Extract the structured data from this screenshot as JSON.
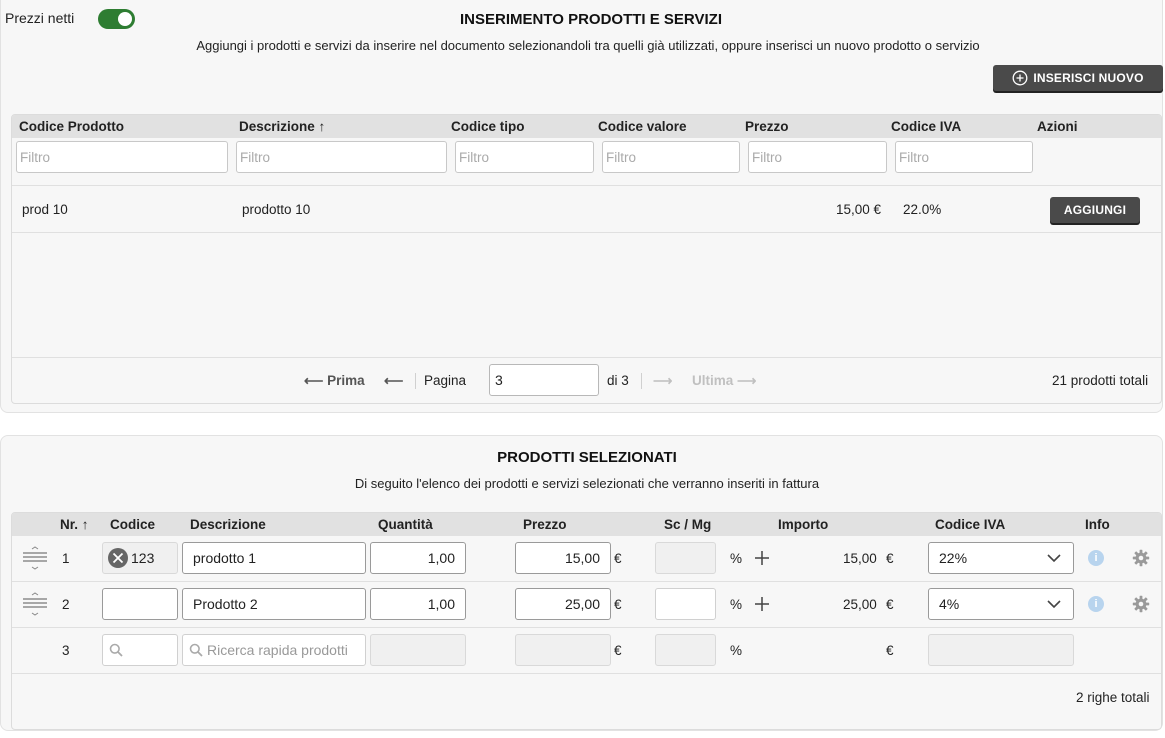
{
  "toggle": {
    "label": "Prezzi netti",
    "checked": true,
    "color": "#2e7d32"
  },
  "insert": {
    "title": "INSERIMENTO PRODOTTI E SERVIZI",
    "subtitle": "Aggiungi i prodotti e servizi da inserire nel documento selezionandoli tra quelli già utilizzati, oppure inserisci un nuovo prodotto o servizio",
    "new_button": "INSERISCI NUOVO",
    "columns": [
      "Codice Prodotto",
      "Descrizione",
      "Codice tipo",
      "Codice valore",
      "Prezzo",
      "Codice IVA",
      "Azioni"
    ],
    "sort_icon": "↑",
    "filter_placeholder": "Filtro",
    "row": {
      "codice": "prod 10",
      "descrizione": "prodotto 10",
      "prezzo": "15,00 €",
      "iva": "22.0%",
      "action": "AGGIUNGI"
    },
    "pager": {
      "first": "Prima",
      "page_label": "Pagina",
      "page_value": "3",
      "of": "di 3",
      "last": "Ultima",
      "total": "21 prodotti totali"
    }
  },
  "selected": {
    "title": "PRODOTTI SELEZIONATI",
    "subtitle": "Di seguito l'elenco dei prodotti e servizi selezionati che verranno inseriti in fattura",
    "columns": [
      "Nr.",
      "Codice",
      "Descrizione",
      "Quantità",
      "Prezzo",
      "Sc / Mg",
      "Importo",
      "Codice IVA",
      "Info"
    ],
    "rows": [
      {
        "nr": "1",
        "codice": "123",
        "descrizione": "prodotto 1",
        "quantita": "1,00",
        "prezzo": "15,00",
        "importo": "15,00",
        "iva": "22%"
      },
      {
        "nr": "2",
        "codice": "",
        "descrizione": "Prodotto 2",
        "quantita": "1,00",
        "prezzo": "25,00",
        "importo": "25,00",
        "iva": "4%"
      }
    ],
    "new_row": {
      "nr": "3",
      "search_placeholder": "Ricerca rapida prodotti"
    },
    "euro": "€",
    "percent": "%",
    "total": "2 righe totali"
  }
}
